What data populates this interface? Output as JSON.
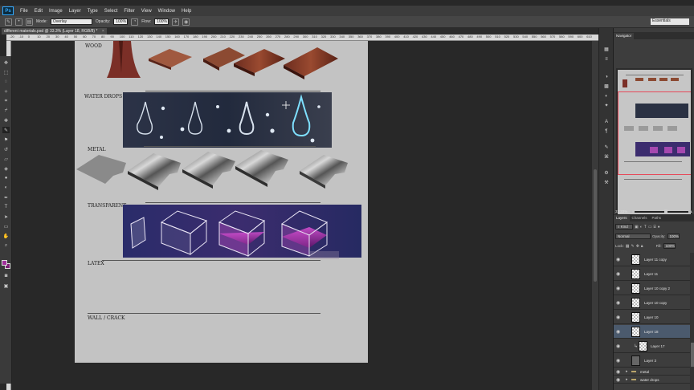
{
  "app": {
    "logo": "Ps"
  },
  "menu": [
    "File",
    "Edit",
    "Image",
    "Layer",
    "Type",
    "Select",
    "Filter",
    "View",
    "Window",
    "Help"
  ],
  "options": {
    "mode_label": "Mode:",
    "mode_value": "Overlay",
    "opacity_label": "Opacity:",
    "opacity_value": "100%",
    "flow_label": "Flow:",
    "flow_value": "100%",
    "workspace": "Essentials"
  },
  "document_tab": {
    "title": "different materials.psd @ 33.3% (Layer 18, RGB/8) *",
    "close": "×"
  },
  "ruler_ticks": [
    "-20",
    "-10",
    "0",
    "10",
    "20",
    "30",
    "40",
    "50",
    "60",
    "70",
    "80",
    "90",
    "100",
    "110",
    "120",
    "130",
    "140",
    "150",
    "160",
    "170",
    "180",
    "190",
    "200",
    "210",
    "220",
    "230",
    "240",
    "250",
    "260",
    "270",
    "280",
    "290",
    "300",
    "310",
    "320",
    "330",
    "340",
    "350",
    "360",
    "370",
    "380",
    "390",
    "400",
    "410",
    "420",
    "430",
    "440",
    "450",
    "460",
    "470",
    "480",
    "490",
    "500",
    "510",
    "520",
    "530",
    "540",
    "550",
    "560",
    "570",
    "580",
    "590",
    "600",
    "610"
  ],
  "canvas": {
    "sections": [
      "WOOD",
      "WATER DROPS",
      "METAL",
      "TRANSPARENT",
      "LATEX",
      "WALL / CRACK"
    ]
  },
  "navigator": {
    "tabs": [
      "Navigator"
    ],
    "zoom": "33.33%"
  },
  "layers_panel": {
    "tabs": [
      "Layers",
      "Channels",
      "Paths"
    ],
    "kind": "Kind",
    "blend_mode": "Normal",
    "opacity_label": "Opacity:",
    "opacity_value": "100%",
    "lock_label": "Lock:",
    "fill_label": "Fill:",
    "fill_value": "100%",
    "layers": [
      {
        "name": "Layer 11 copy",
        "selected": false
      },
      {
        "name": "Layer 11",
        "selected": false
      },
      {
        "name": "Layer 10 copy 2",
        "selected": false
      },
      {
        "name": "Layer 10 copy",
        "selected": false
      },
      {
        "name": "Layer 10",
        "selected": false
      },
      {
        "name": "Layer 18",
        "selected": true
      },
      {
        "name": "Layer 17",
        "selected": false
      },
      {
        "name": "Layer 3",
        "selected": false
      }
    ],
    "groups": [
      "metal",
      "water drops"
    ]
  },
  "colors": {
    "foreground": "#a12f9b",
    "accent_frame": "#e64a5a",
    "selected_layer": "#4b5a6d"
  }
}
